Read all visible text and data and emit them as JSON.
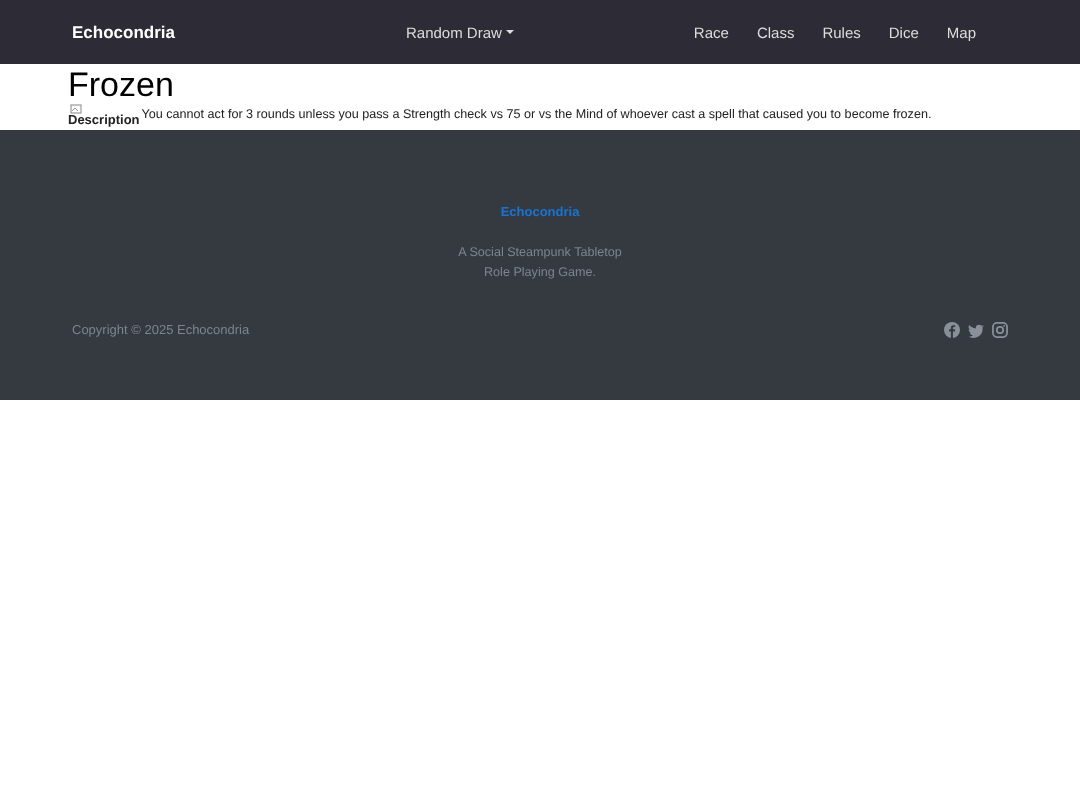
{
  "navbar": {
    "brand": "Echocondria",
    "dropdown": "Random Draw",
    "links": [
      "Race",
      "Class",
      "Rules",
      "Dice",
      "Map"
    ]
  },
  "page": {
    "title": "Frozen",
    "label": "Description",
    "description": "You cannot act for 3 rounds unless you pass a Strength check vs 75 or vs the Mind of whoever cast a spell that caused you to become frozen."
  },
  "footer": {
    "brand": "Echocondria",
    "tagline_lines": [
      "A Social Steampunk Tabletop",
      "Role Playing Game."
    ],
    "copyright": "Copyright © 2025 Echocondria"
  }
}
